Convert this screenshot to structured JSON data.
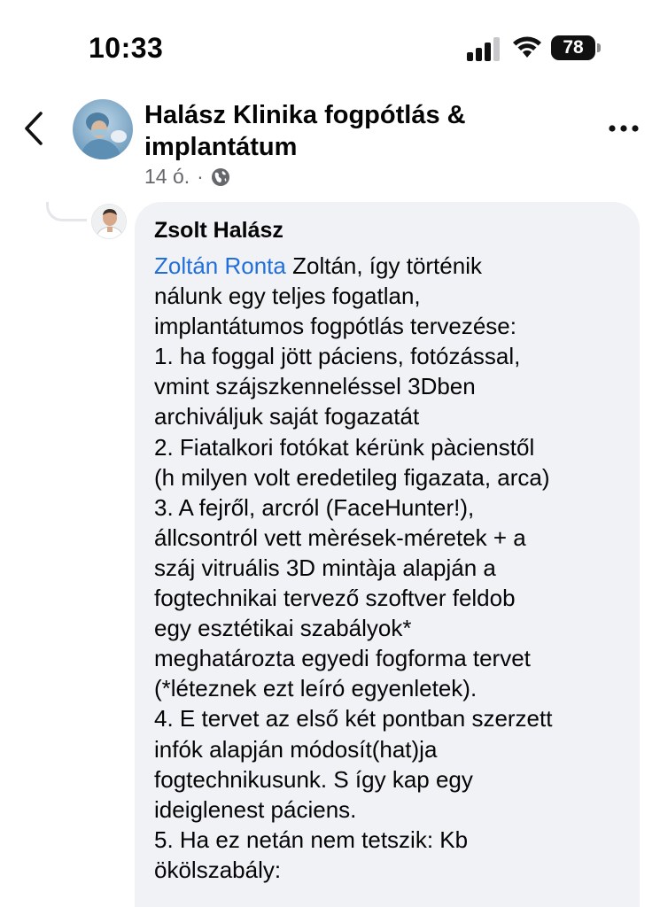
{
  "status_bar": {
    "time": "10:33",
    "battery_level": "78"
  },
  "header": {
    "page_name": "Halász Klinika fogpótlás & implantátum",
    "post_age": "14 ó.",
    "separator": "·",
    "audience_icon": "globe-icon"
  },
  "comment": {
    "author": "Zsolt Halász",
    "mention": "Zoltán Ronta",
    "first_line_rest": " Zoltán, így történik",
    "lines": [
      "nálunk egy teljes fogatlan,",
      "implantátumos fogpótlás tervezése:",
      "1. ha foggal jött páciens, fotózással,",
      "vmint szájszkenneléssel 3Dben",
      "archiváljuk saját fogazatát",
      "2. Fiatalkori fotókat kérünk pàcienstől",
      "(h milyen volt eredetileg figazata, arca)",
      "3. A fejről, arcról (FaceHunter!),",
      "állcsontról vett mèrések-méretek + a",
      "száj vitruális 3D mintàja alapján a",
      "fogtechnikai tervező szoftver feldob",
      "egy esztétikai szabályok*",
      "meghatározta egyedi fogforma tervet",
      "(*léteznek ezt leíró egyenletek).",
      "4. E tervet az első két pontban szerzett",
      "infók alapján módosít(hat)ja",
      "fogtechnikusunk. S így kap egy",
      "ideiglenest páciens.",
      "5. Ha ez netán nem tetszik: Kb",
      "ökölszabály:"
    ]
  },
  "colors": {
    "link": "#216fdb",
    "bubble": "#f0f2f5",
    "muted": "#65676b"
  }
}
